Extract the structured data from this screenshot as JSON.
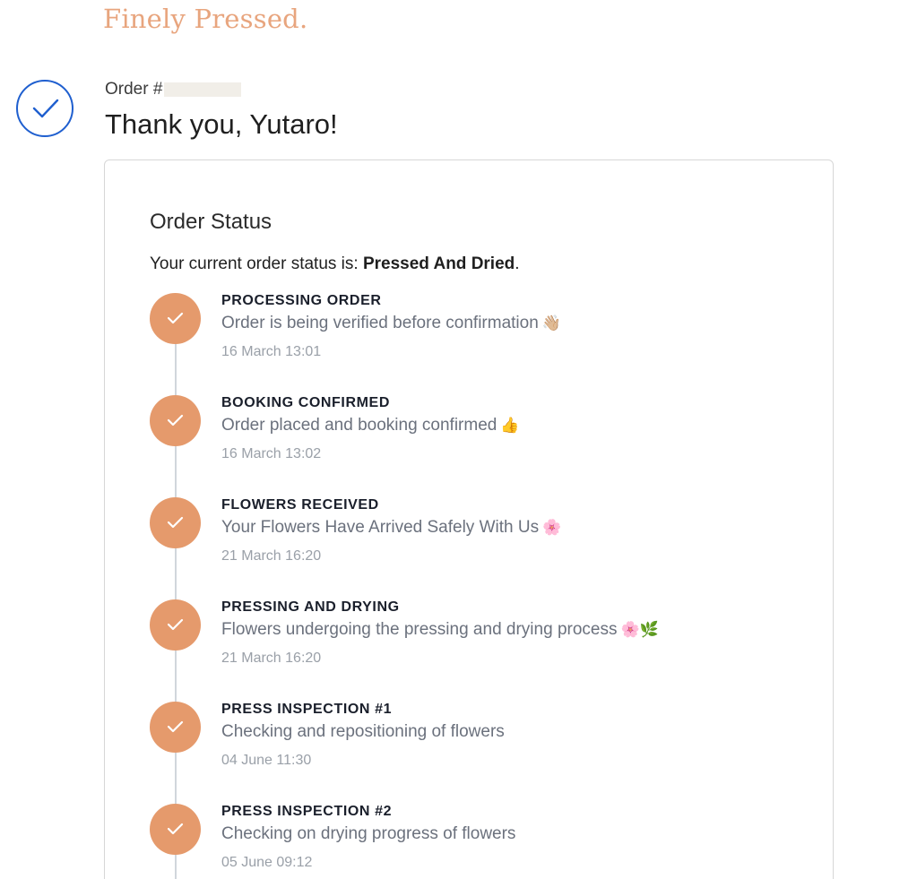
{
  "brand": {
    "name": "Finely Pressed."
  },
  "order": {
    "number_label": "Order #",
    "thanks": "Thank you, Yutaro!"
  },
  "status_card": {
    "title": "Order Status",
    "current_status_prefix": "Your current order status is: ",
    "current_status_value": "Pressed And Dried",
    "current_status_suffix": "."
  },
  "colors": {
    "brand": "#e8a57e",
    "success_icon": "#1f5fcf",
    "step_dot": "#e59a6c"
  },
  "steps": [
    {
      "title": "PROCESSING ORDER",
      "description": "Order is being verified before confirmation",
      "emoji": "👋🏼",
      "time": "16 March 13:01"
    },
    {
      "title": "BOOKING CONFIRMED",
      "description": "Order placed and booking confirmed",
      "emoji": "👍",
      "time": "16 March 13:02"
    },
    {
      "title": "FLOWERS RECEIVED",
      "description": "Your Flowers Have Arrived Safely With Us",
      "emoji": "🌸",
      "time": "21 March 16:20"
    },
    {
      "title": "PRESSING AND DRYING",
      "description": "Flowers undergoing the pressing and drying process",
      "emoji": "🌸🌿",
      "time": "21 March 16:20"
    },
    {
      "title": "PRESS INSPECTION #1",
      "description": "Checking and repositioning of flowers",
      "emoji": "",
      "time": "04 June 11:30"
    },
    {
      "title": "PRESS INSPECTION #2",
      "description": "Checking on drying progress of flowers",
      "emoji": "",
      "time": "05 June 09:12"
    }
  ]
}
